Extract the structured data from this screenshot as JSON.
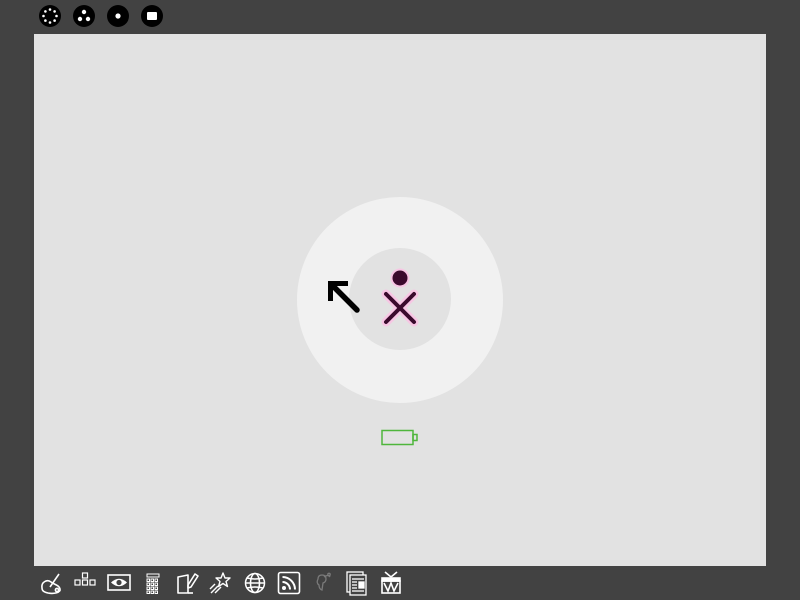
{
  "window": {
    "frame_color": "#424242",
    "canvas_color": "#e2e2e2",
    "ring_color": "#f1f1f1"
  },
  "zoom_bar": {
    "items": [
      {
        "name": "neighborhood-view",
        "icon": "dotted-circle-icon"
      },
      {
        "name": "group-view",
        "icon": "three-dots-icon"
      },
      {
        "name": "home-view",
        "icon": "single-dot-icon"
      },
      {
        "name": "activity-view",
        "icon": "square-icon"
      }
    ]
  },
  "home": {
    "xo_colors": {
      "stroke": "#3b0a2d",
      "fill": "#f7c6e4"
    },
    "battery_color": "#4fb63c"
  },
  "activities": [
    {
      "name": "paint",
      "icon": "paint-palette-icon"
    },
    {
      "name": "log",
      "icon": "blocks-icon"
    },
    {
      "name": "view-source",
      "icon": "eye-icon"
    },
    {
      "name": "calculate",
      "icon": "calculator-icon"
    },
    {
      "name": "write",
      "icon": "write-notebook-icon"
    },
    {
      "name": "record",
      "icon": "shooting-star-icon"
    },
    {
      "name": "browse",
      "icon": "globe-icon"
    },
    {
      "name": "news-reader",
      "icon": "rss-icon"
    },
    {
      "name": "chat",
      "icon": "faded-speech-icon"
    },
    {
      "name": "read",
      "icon": "newspaper-icon"
    },
    {
      "name": "tamtam",
      "icon": "drum-icon"
    }
  ]
}
